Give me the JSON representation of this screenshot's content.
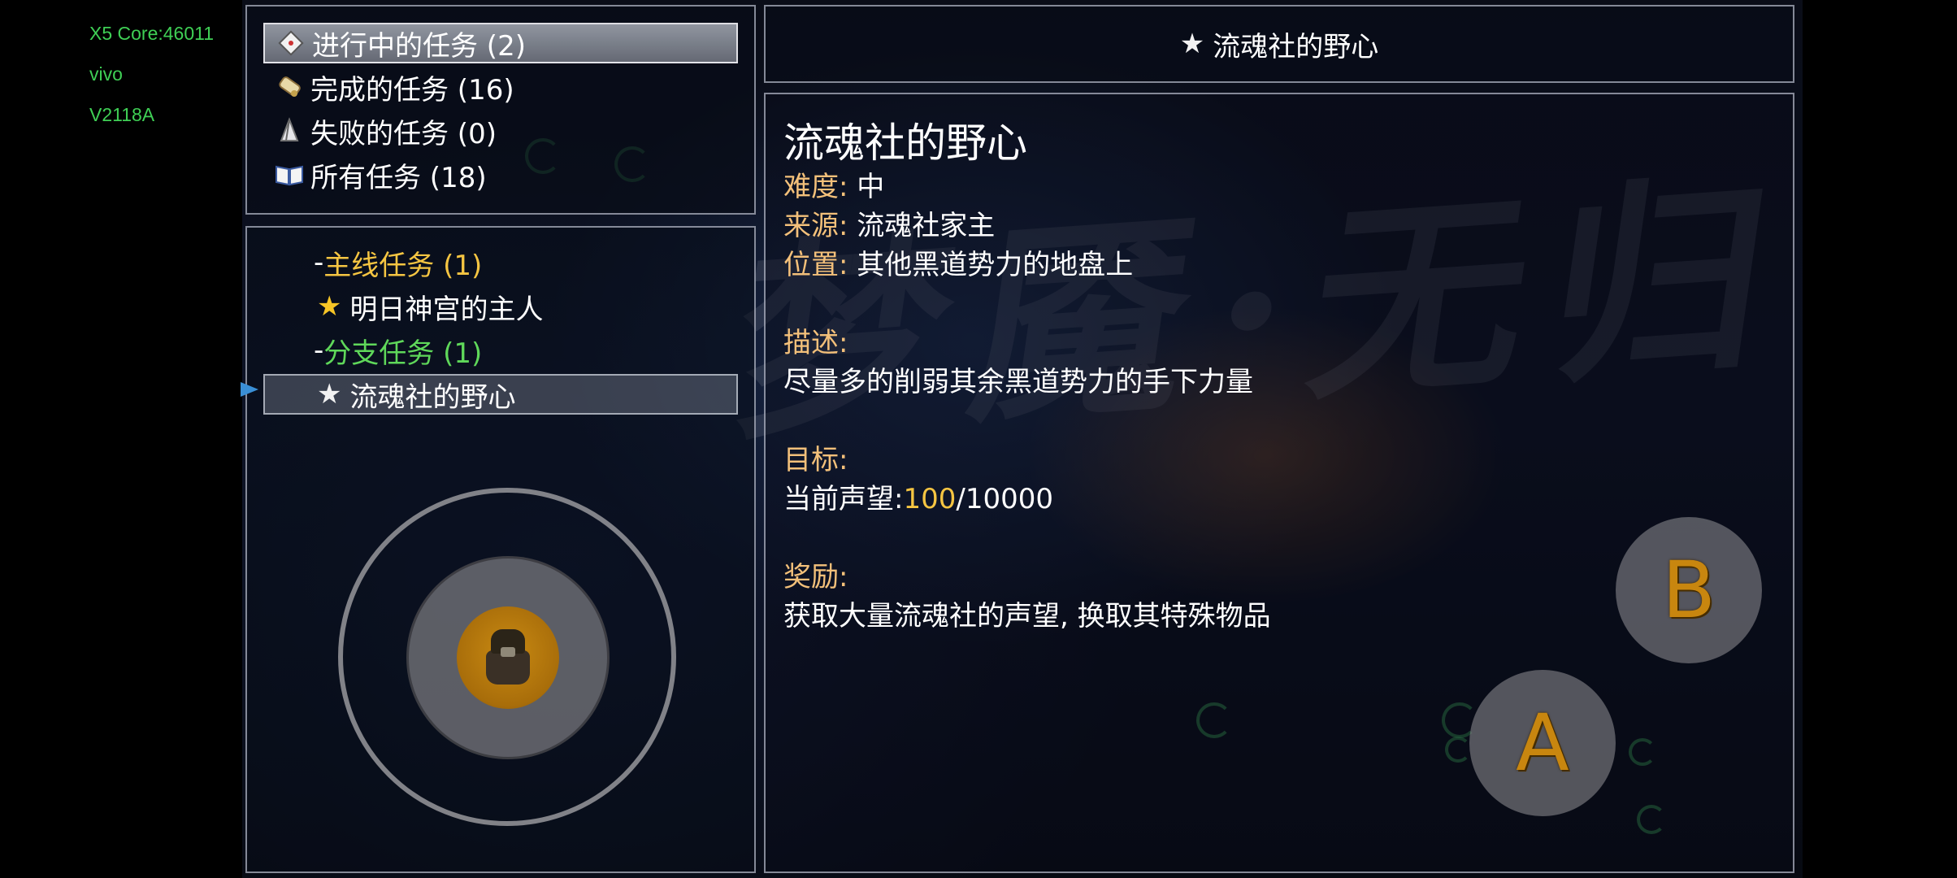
{
  "device_info": {
    "core": "X5 Core:46011",
    "brand": "vivo",
    "model": "V2118A"
  },
  "background": {
    "watermark_text": "梦魇·无归"
  },
  "categories": [
    {
      "icon": "scroll-tag-icon",
      "label": "进行中的任务 (2)",
      "selected": true
    },
    {
      "icon": "rolled-scroll-icon",
      "label": "完成的任务 (16)",
      "selected": false
    },
    {
      "icon": "broken-sail-icon",
      "label": "失败的任务 (0)",
      "selected": false
    },
    {
      "icon": "open-book-icon",
      "label": "所有任务 (18)",
      "selected": false
    }
  ],
  "task_list": {
    "main_group": {
      "dash": "-",
      "label": "主线任务 (1)"
    },
    "main_tasks": [
      {
        "icon": "gold-star-icon",
        "label": "明日神宫的主人"
      }
    ],
    "side_group": {
      "dash": "-",
      "label": "分支任务 (1)"
    },
    "side_tasks": [
      {
        "icon": "white-star-icon",
        "label": "流魂社的野心",
        "selected": true
      }
    ]
  },
  "title_bar": {
    "icon": "white-star-icon",
    "title": "流魂社的野心"
  },
  "detail": {
    "title": "流魂社的野心",
    "difficulty_label": "难度:",
    "difficulty_value": "中",
    "source_label": "来源:",
    "source_value": "流魂社家主",
    "location_label": "位置:",
    "location_value": "其他黑道势力的地盘上",
    "description_label": "描述:",
    "description_value": "尽量多的削弱其余黑道势力的手下力量",
    "goal_label": "目标:",
    "goal_prefix": "当前声望:",
    "goal_current": "100",
    "goal_total": "/10000",
    "reward_label": "奖励:",
    "reward_value": "获取大量流魂社的声望, 换取其特殊物品"
  },
  "controls": {
    "button_b": "B",
    "button_a": "A"
  },
  "colors": {
    "label_orange": "#f3c07a",
    "main_task_yellow": "#f5c542",
    "side_task_green": "#5fd85a",
    "device_text_green": "#3fcf55"
  }
}
